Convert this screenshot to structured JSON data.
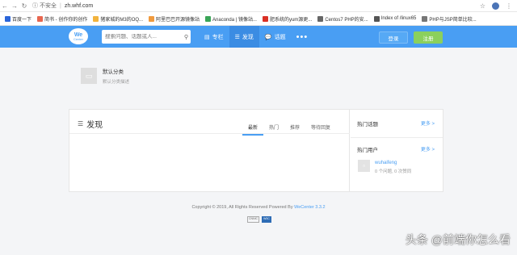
{
  "browser": {
    "secure_label": "不安全",
    "url": "zh.whf.com",
    "bookmarks": [
      {
        "label": "百度一下",
        "color": "#2b65d9"
      },
      {
        "label": "简书 - 创作你的创作",
        "color": "#e8664f"
      },
      {
        "label": "猪家城的M3的OQ...",
        "color": "#f2b33d"
      },
      {
        "label": "阿里巴巴开源镜像站",
        "color": "#f09a3d"
      },
      {
        "label": "Anaconda | 镜像站...",
        "color": "#3aa557"
      },
      {
        "label": "肥系统的yum源更...",
        "color": "#d93025"
      },
      {
        "label": "Centos7 PHP的安...",
        "color": "#666666"
      },
      {
        "label": "Index of /linux65",
        "color": "#555555"
      },
      {
        "label": "PHP与JSP简单比较...",
        "color": "#777777"
      }
    ]
  },
  "header": {
    "logo_main": "We",
    "logo_sub": "Center",
    "search_placeholder": "搜索问题、话题或人...",
    "nav": [
      {
        "label": "专栏",
        "icon": "columns-icon"
      },
      {
        "label": "发现",
        "icon": "list-icon"
      },
      {
        "label": "话题",
        "icon": "chat-icon"
      }
    ],
    "more": "•••",
    "login": "登录",
    "register": "注册"
  },
  "category": {
    "name": "默认分类",
    "desc": "默认分类描述"
  },
  "discover": {
    "title": "发现",
    "tabs": [
      "最新",
      "热门",
      "推荐",
      "等待回复"
    ]
  },
  "sidebar": {
    "hot_topics": "热门话题",
    "hot_users": "热门用户",
    "more": "更多 >",
    "user_name": "wuhaifeng",
    "user_stats": "0 个问题, 0 次赞同"
  },
  "footer": {
    "text": "Copyright © 2019, All Rights Reserved Powered By ",
    "brand": "WeCenter 3.3.2",
    "badge1": "CNNIC",
    "badge2": "W3C"
  },
  "watermark": "头条 @前端你怎么看"
}
